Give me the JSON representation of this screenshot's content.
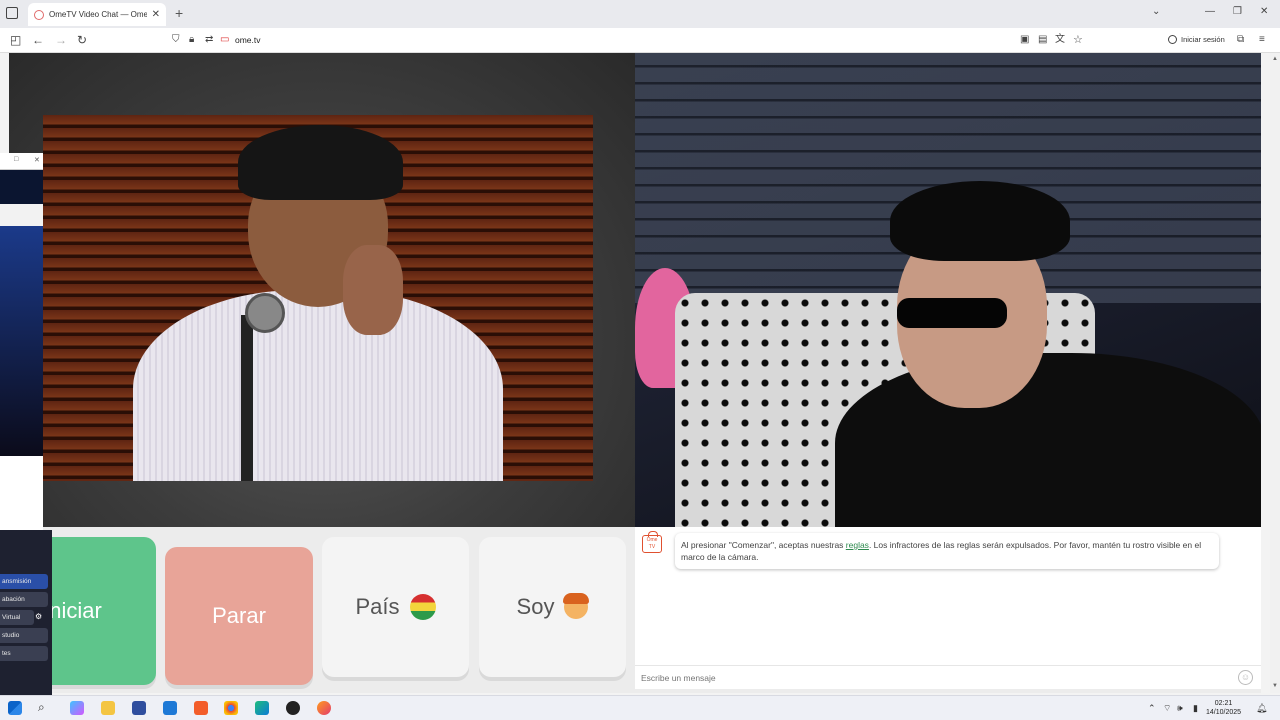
{
  "browser": {
    "tab_title": "OmeTV Video Chat — Omegle",
    "tab_close": "✕",
    "new_tab": "+",
    "url": "ome.tv",
    "signin_label": "Iniciar sesión",
    "window_controls": [
      "⌄",
      "—",
      "❐",
      "✕"
    ]
  },
  "controls": {
    "start_label": "Iniciar",
    "stop_label": "Parar",
    "country_label": "País",
    "gender_label": "Soy"
  },
  "chat": {
    "logo_text": "Ome TV",
    "message_before_link": "Al presionar \"Comenzar\", aceptas nuestras ",
    "message_link": "reglas",
    "message_after_link": ". Los infractores de las reglas serán expulsados. Por favor, mantén tu rostro visible en el marco de la cámara.",
    "input_placeholder": "Escribe un mensaje"
  },
  "obs_panel": {
    "buttons": [
      "ansmisión",
      "abación",
      "Virtual",
      "studio",
      "tes"
    ]
  },
  "taskbar": {
    "time": "02:21",
    "date": "14/10/2025"
  },
  "colors": {
    "start": "#5ec58b",
    "stop": "#e8a498",
    "link": "#2d8a4e",
    "logo": "#e0502f"
  }
}
